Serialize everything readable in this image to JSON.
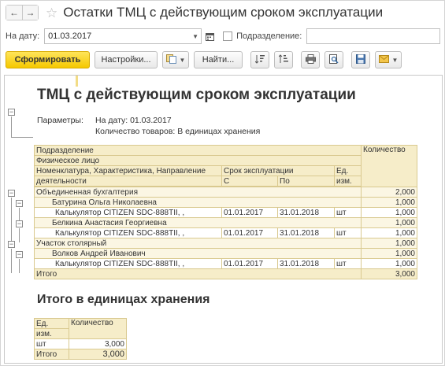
{
  "window": {
    "title": "Остатки ТМЦ с действующим сроком эксплуатации"
  },
  "filters": {
    "date_label": "На дату:",
    "date_value": "01.03.2017",
    "subdivision_label": "Подразделение:",
    "subdivision_value": ""
  },
  "toolbar": {
    "generate": "Сформировать",
    "settings": "Настройки...",
    "find": "Найти..."
  },
  "report": {
    "title": "ТМЦ с действующим сроком эксплуатации",
    "params_label": "Параметры:",
    "param_date": "На дату: 01.03.2017",
    "param_units": "Количество товаров: В единицах хранения",
    "headers": {
      "subdivision": "Подразделение",
      "person": "Физическое лицо",
      "nomenclature_1": "Номенклатура, Характеристика, Направление",
      "nomenclature_2": "деятельности",
      "period": "Срок эксплуатации",
      "from": "С",
      "to": "По",
      "unit_1": "Ед.",
      "unit_2": "изм.",
      "quantity": "Количество"
    },
    "rows": [
      {
        "name": "Объединенная бухгалтерия",
        "from": "",
        "to": "",
        "unit": "",
        "qty": "2,000"
      },
      {
        "name": "Батурина Ольга Николаевна",
        "from": "",
        "to": "",
        "unit": "",
        "qty": "1,000"
      },
      {
        "name": "Калькулятор CITIZEN SDC-888TII, ,",
        "from": "01.01.2017",
        "to": "31.01.2018",
        "unit": "шт",
        "qty": "1,000"
      },
      {
        "name": "Белкина Анастасия Георгиевна",
        "from": "",
        "to": "",
        "unit": "",
        "qty": "1,000"
      },
      {
        "name": "Калькулятор CITIZEN SDC-888TII, ,",
        "from": "01.01.2017",
        "to": "31.01.2018",
        "unit": "шт",
        "qty": "1,000"
      },
      {
        "name": "Участок столярный",
        "from": "",
        "to": "",
        "unit": "",
        "qty": "1,000"
      },
      {
        "name": "Волков Андрей Иванович",
        "from": "",
        "to": "",
        "unit": "",
        "qty": "1,000"
      },
      {
        "name": "Калькулятор CITIZEN SDC-888TII, ,",
        "from": "01.01.2017",
        "to": "31.01.2018",
        "unit": "шт",
        "qty": "1,000"
      }
    ],
    "total_label": "Итого",
    "total_value": "3,000"
  },
  "summary": {
    "title": "Итого в единицах хранения",
    "h_unit_1": "Ед.",
    "h_unit_2": "изм.",
    "h_qty": "Количество",
    "row_unit": "шт",
    "row_qty": "3,000",
    "total_label": "Итого",
    "total_value": "3,000"
  },
  "icons": [
    "back-arrow-icon",
    "forward-arrow-icon",
    "star-icon",
    "calendar-icon",
    "copy-icon",
    "sort-asc-icon",
    "sort-desc-icon",
    "print-icon",
    "preview-icon",
    "save-icon",
    "mail-icon"
  ]
}
